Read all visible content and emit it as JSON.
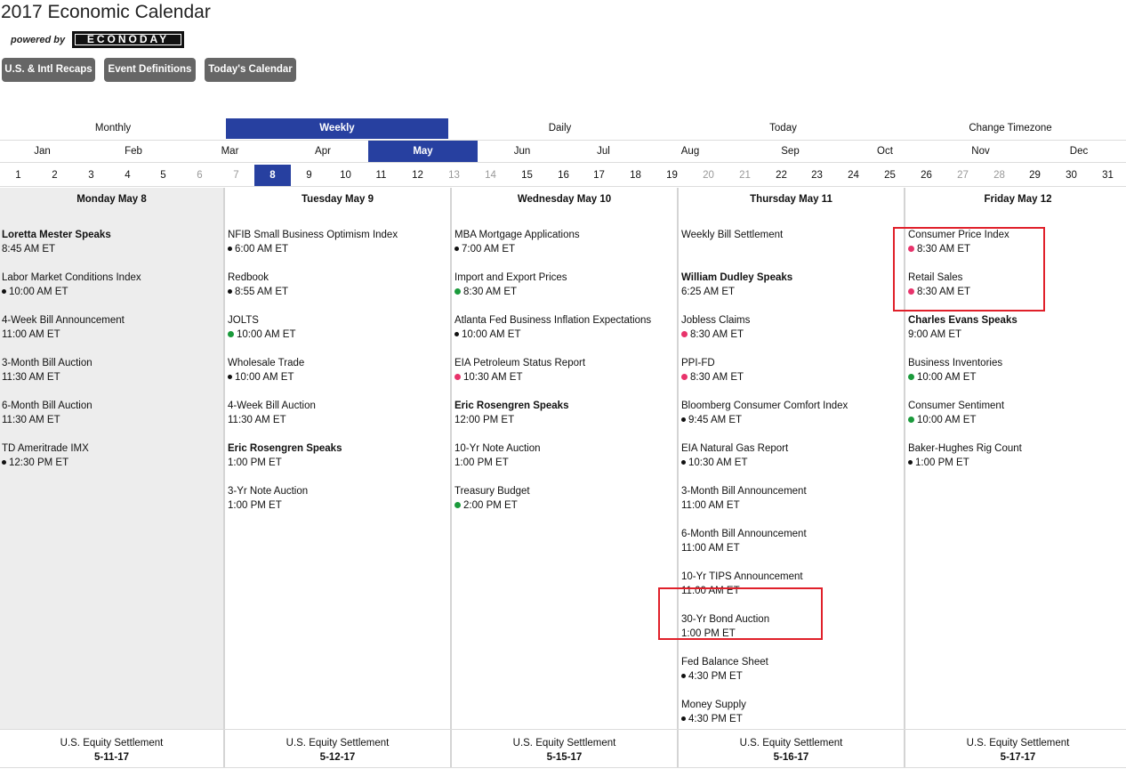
{
  "page_title": "2017 Economic Calendar",
  "powered_by": "powered by",
  "brand_logo_text": "ECONODAY",
  "buttons": [
    {
      "label": "U.S. & Intl Recaps"
    },
    {
      "label": "Event Definitions"
    },
    {
      "label": "Today's Calendar"
    }
  ],
  "view_tabs": [
    {
      "label": "Monthly"
    },
    {
      "label": "Weekly"
    },
    {
      "label": "Daily"
    },
    {
      "label": "Today"
    },
    {
      "label": "Change Timezone"
    }
  ],
  "selected_view": "Weekly",
  "months": [
    "Jan",
    "Feb",
    "Mar",
    "Apr",
    "May",
    "Jun",
    "Jul",
    "Aug",
    "Sep",
    "Oct",
    "Nov",
    "Dec"
  ],
  "selected_month": "May",
  "days": [
    "1",
    "2",
    "3",
    "4",
    "5",
    "6",
    "7",
    "8",
    "9",
    "10",
    "11",
    "12",
    "13",
    "14",
    "15",
    "16",
    "17",
    "18",
    "19",
    "20",
    "21",
    "22",
    "23",
    "24",
    "25",
    "26",
    "27",
    "28",
    "29",
    "30",
    "31"
  ],
  "selected_day": "8",
  "weekend_days": [
    "6",
    "7",
    "13",
    "14",
    "20",
    "21",
    "27",
    "28"
  ],
  "colors": {
    "accent": "#2740a0",
    "button_gray": "#666666",
    "dot_black": "#111111",
    "dot_red": "#e8336b",
    "dot_green": "#1a9a3b",
    "highlight_box": "#e0202a",
    "today_column_bg": "#ededed"
  },
  "week": [
    {
      "header": "Monday May 8",
      "events": [
        {
          "name": "Loretta Mester Speaks",
          "time": "8:45 AM ET",
          "bold": true,
          "dot": null
        },
        {
          "name": "Labor Market Conditions Index",
          "time": "10:00 AM ET",
          "bold": false,
          "dot": "black"
        },
        {
          "name": "4-Week Bill Announcement",
          "time": "11:00 AM ET",
          "bold": false,
          "dot": null
        },
        {
          "name": "3-Month Bill Auction",
          "time": "11:30 AM ET",
          "bold": false,
          "dot": null
        },
        {
          "name": "6-Month Bill Auction",
          "time": "11:30 AM ET",
          "bold": false,
          "dot": null
        },
        {
          "name": "TD Ameritrade IMX",
          "time": "12:30 PM ET",
          "bold": false,
          "dot": "black"
        }
      ],
      "footer": {
        "label": "U.S. Equity Settlement",
        "date": "5-11-17"
      }
    },
    {
      "header": "Tuesday May 9",
      "events": [
        {
          "name": "NFIB Small Business Optimism Index",
          "time": "6:00 AM ET",
          "bold": false,
          "dot": "black"
        },
        {
          "name": "Redbook",
          "time": "8:55 AM ET",
          "bold": false,
          "dot": "black"
        },
        {
          "name": "JOLTS",
          "time": "10:00 AM ET",
          "bold": false,
          "dot": "green"
        },
        {
          "name": "Wholesale Trade",
          "time": "10:00 AM ET",
          "bold": false,
          "dot": "black"
        },
        {
          "name": "4-Week Bill Auction",
          "time": "11:30 AM ET",
          "bold": false,
          "dot": null
        },
        {
          "name": "Eric Rosengren Speaks",
          "time": "1:00 PM ET",
          "bold": true,
          "dot": null
        },
        {
          "name": "3-Yr Note Auction",
          "time": "1:00 PM ET",
          "bold": false,
          "dot": null
        }
      ],
      "footer": {
        "label": "U.S. Equity Settlement",
        "date": "5-12-17"
      }
    },
    {
      "header": "Wednesday May 10",
      "events": [
        {
          "name": "MBA Mortgage Applications",
          "time": "7:00 AM ET",
          "bold": false,
          "dot": "black"
        },
        {
          "name": "Import and Export Prices",
          "time": "8:30 AM ET",
          "bold": false,
          "dot": "green"
        },
        {
          "name": "Atlanta Fed Business Inflation Expectations",
          "time": "10:00 AM ET",
          "bold": false,
          "dot": "black"
        },
        {
          "name": "EIA Petroleum Status Report",
          "time": "10:30 AM ET",
          "bold": false,
          "dot": "red"
        },
        {
          "name": "Eric Rosengren Speaks",
          "time": "12:00 PM ET",
          "bold": true,
          "dot": null
        },
        {
          "name": "10-Yr Note Auction",
          "time": "1:00 PM ET",
          "bold": false,
          "dot": null
        },
        {
          "name": "Treasury Budget",
          "time": "2:00 PM ET",
          "bold": false,
          "dot": "green"
        }
      ],
      "footer": {
        "label": "U.S. Equity Settlement",
        "date": "5-15-17"
      }
    },
    {
      "header": "Thursday May 11",
      "events": [
        {
          "name": "Weekly Bill Settlement",
          "time": "",
          "bold": false,
          "dot": null
        },
        {
          "name": "William Dudley Speaks",
          "time": "6:25 AM ET",
          "bold": true,
          "dot": null
        },
        {
          "name": "Jobless Claims",
          "time": "8:30 AM ET",
          "bold": false,
          "dot": "red"
        },
        {
          "name": "PPI-FD",
          "time": "8:30 AM ET",
          "bold": false,
          "dot": "red"
        },
        {
          "name": "Bloomberg Consumer Comfort Index",
          "time": "9:45 AM ET",
          "bold": false,
          "dot": "black"
        },
        {
          "name": "EIA Natural Gas Report",
          "time": "10:30 AM ET",
          "bold": false,
          "dot": "black"
        },
        {
          "name": "3-Month Bill Announcement",
          "time": "11:00 AM ET",
          "bold": false,
          "dot": null
        },
        {
          "name": "6-Month Bill Announcement",
          "time": "11:00 AM ET",
          "bold": false,
          "dot": null
        },
        {
          "name": "10-Yr TIPS Announcement",
          "time": "11:00 AM ET",
          "bold": false,
          "dot": null
        },
        {
          "name": "30-Yr Bond Auction",
          "time": "1:00 PM ET",
          "bold": false,
          "dot": null
        },
        {
          "name": "Fed Balance Sheet",
          "time": "4:30 PM ET",
          "bold": false,
          "dot": "black"
        },
        {
          "name": "Money Supply",
          "time": "4:30 PM ET",
          "bold": false,
          "dot": "black"
        }
      ],
      "footer": {
        "label": "U.S. Equity Settlement",
        "date": "5-16-17"
      }
    },
    {
      "header": "Friday May 12",
      "events": [
        {
          "name": "Consumer Price Index",
          "time": "8:30 AM ET",
          "bold": false,
          "dot": "red"
        },
        {
          "name": "Retail Sales",
          "time": "8:30 AM ET",
          "bold": false,
          "dot": "red"
        },
        {
          "name": "Charles Evans Speaks",
          "time": "9:00 AM ET",
          "bold": true,
          "dot": null
        },
        {
          "name": "Business Inventories",
          "time": "10:00 AM ET",
          "bold": false,
          "dot": "green"
        },
        {
          "name": "Consumer Sentiment",
          "time": "10:00 AM ET",
          "bold": false,
          "dot": "green"
        },
        {
          "name": "Baker-Hughes Rig Count",
          "time": "1:00 PM ET",
          "bold": false,
          "dot": "black"
        }
      ],
      "footer": {
        "label": "U.S. Equity Settlement",
        "date": "5-17-17"
      }
    }
  ]
}
